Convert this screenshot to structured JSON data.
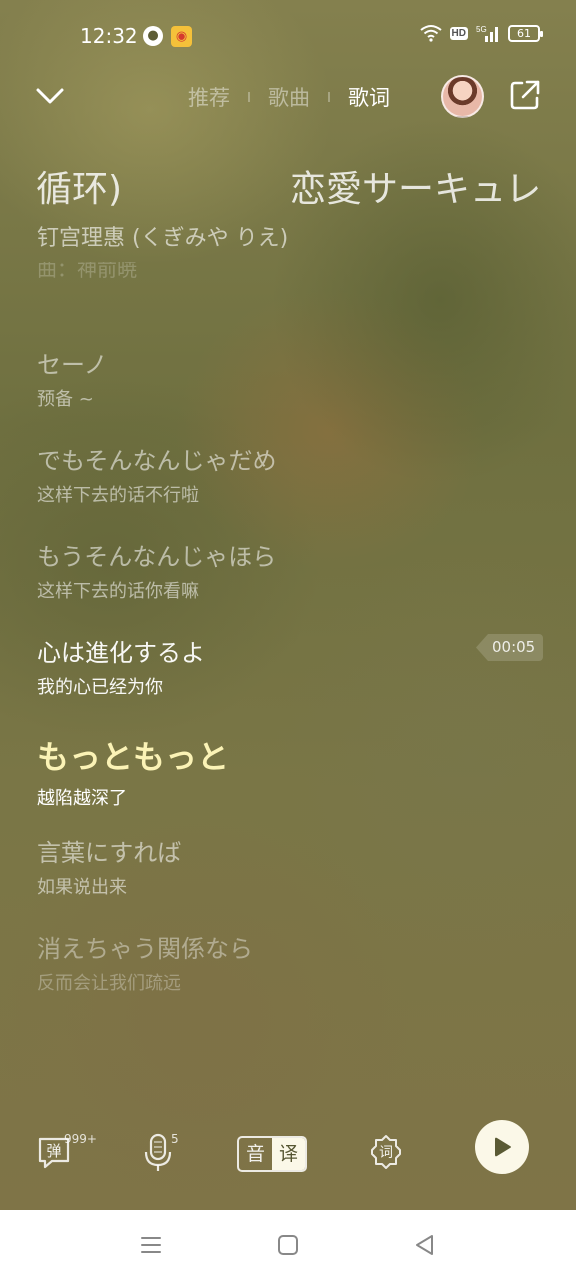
{
  "status_bar": {
    "time": "12:32",
    "hd": "HD",
    "network": "5G",
    "battery": "61"
  },
  "header": {
    "tabs": [
      {
        "label": "推荐",
        "active": false
      },
      {
        "label": "歌曲",
        "active": false
      },
      {
        "label": "歌词",
        "active": true
      }
    ]
  },
  "song": {
    "title_part_a": "循环)",
    "title_part_b": "恋愛サーキュレ",
    "artist": "钉宫理惠 (くぎみや りえ)",
    "credit_partial": "曲：神前暁"
  },
  "lyrics": [
    {
      "jp": "セーノ",
      "cn": "预备 ~",
      "state": "normal"
    },
    {
      "jp": "でもそんなんじゃだめ",
      "cn": "这样下去的话不行啦",
      "state": "normal"
    },
    {
      "jp": "もうそんなんじゃほら",
      "cn": "这样下去的话你看嘛",
      "state": "normal"
    },
    {
      "jp": "心は進化するよ",
      "cn": "我的心已经为你",
      "state": "current"
    },
    {
      "jp": "もっともっと",
      "cn": "越陷越深了",
      "state": "highlight"
    },
    {
      "jp": "言葉にすれば",
      "cn": "如果说出来",
      "state": "normal"
    },
    {
      "jp": "消えちゃう関係なら",
      "cn": "反而会让我们疏远",
      "state": "fade"
    }
  ],
  "time_marker": "00:05",
  "toolbar": {
    "danmaku_label": "弹",
    "danmaku_count": "999+",
    "sing_count": "5",
    "toggle_original": "音",
    "toggle_translate": "译",
    "lyric_style_label": "词"
  },
  "colors": {
    "highlight_lyric": "#fbf3b6",
    "play_button": "#fbf8e8"
  }
}
